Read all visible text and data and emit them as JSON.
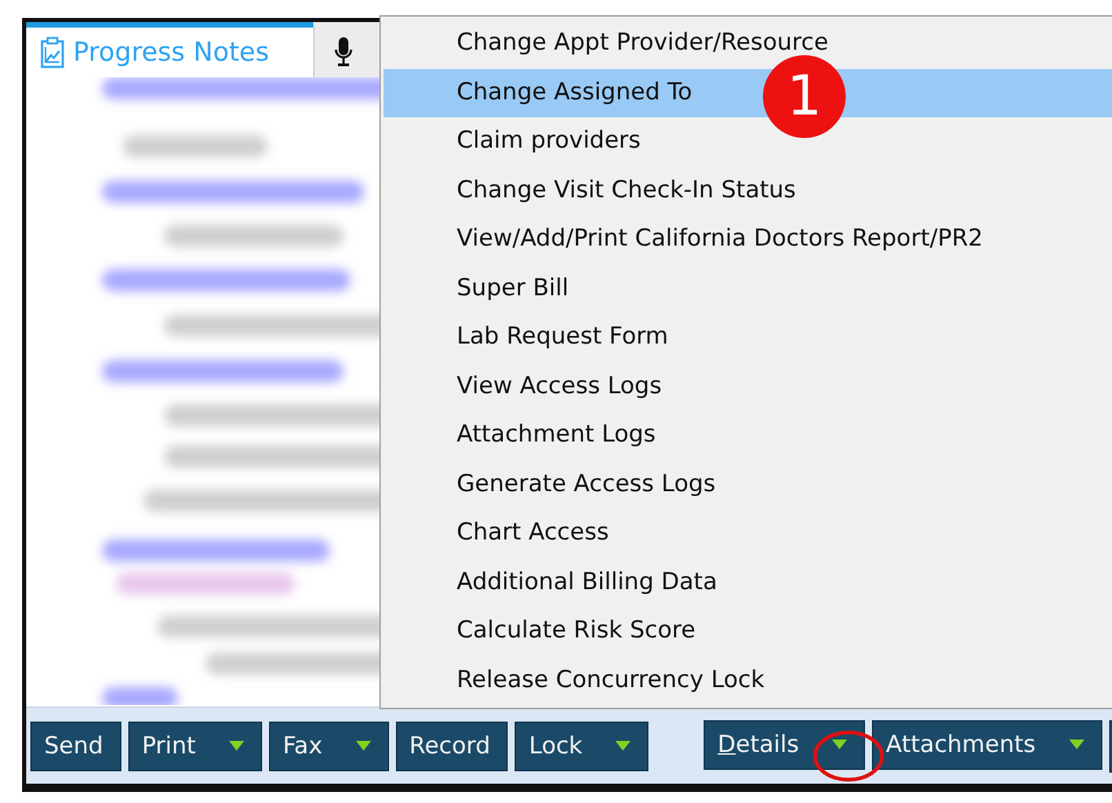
{
  "tabs": [
    {
      "label": "Progress Notes",
      "selected": true
    },
    {
      "selected": false
    }
  ],
  "context_menu": {
    "items": [
      {
        "label": "Change Appt Provider/Resource",
        "selected": false
      },
      {
        "label": "Change Assigned To",
        "selected": true
      },
      {
        "label": "Claim providers",
        "selected": false
      },
      {
        "label": "Change Visit Check-In Status",
        "selected": false
      },
      {
        "label": "View/Add/Print California Doctors Report/PR2",
        "selected": false
      },
      {
        "label": "Super Bill",
        "selected": false
      },
      {
        "label": "Lab Request Form",
        "selected": false
      },
      {
        "label": "View Access Logs",
        "selected": false
      },
      {
        "label": "Attachment Logs",
        "selected": false
      },
      {
        "label": "Generate Access Logs",
        "selected": false
      },
      {
        "label": "Chart Access",
        "selected": false
      },
      {
        "label": "Additional Billing Data",
        "selected": false
      },
      {
        "label": "Calculate Risk Score",
        "selected": false
      },
      {
        "label": "Release Concurrency Lock",
        "selected": false
      }
    ]
  },
  "toolbar": {
    "left": [
      {
        "label": "Send",
        "dropdown": false
      },
      {
        "label": "Print",
        "dropdown": true
      },
      {
        "label": "Fax",
        "dropdown": true
      },
      {
        "label": "Record",
        "dropdown": false
      },
      {
        "label": "Lock",
        "dropdown": true
      }
    ],
    "right": [
      {
        "label": "Details",
        "dropdown": true,
        "underlined_initial": true
      },
      {
        "label": "Attachments",
        "dropdown": true
      }
    ]
  },
  "annotations": {
    "step_badge": "1"
  }
}
